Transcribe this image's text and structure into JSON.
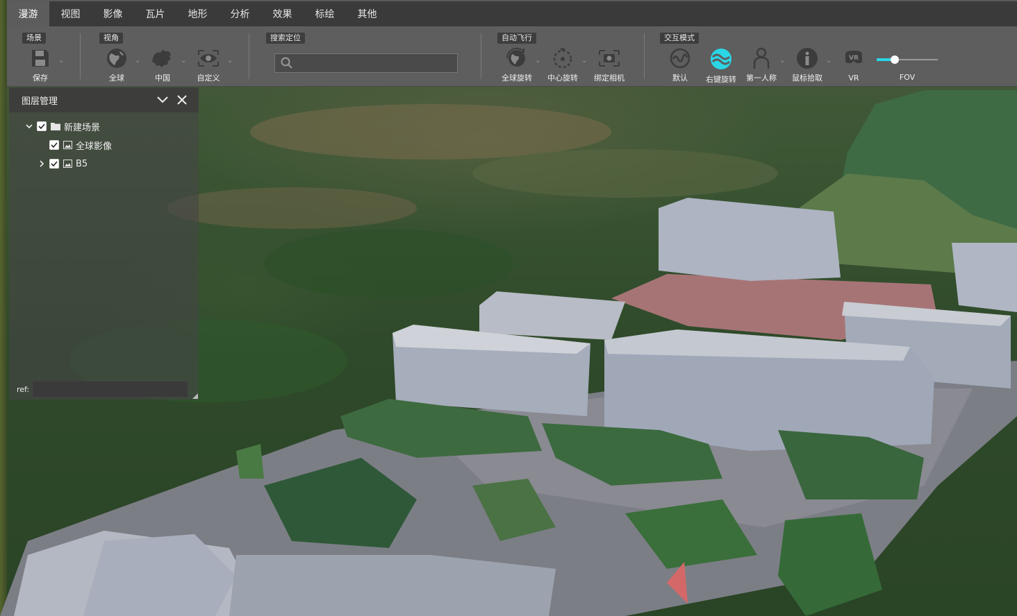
{
  "menu": {
    "tabs": [
      {
        "label": "漫游",
        "active": true
      },
      {
        "label": "视图"
      },
      {
        "label": "影像"
      },
      {
        "label": "瓦片"
      },
      {
        "label": "地形"
      },
      {
        "label": "分析"
      },
      {
        "label": "效果"
      },
      {
        "label": "标绘"
      },
      {
        "label": "其他"
      }
    ]
  },
  "toolbar": {
    "groups": {
      "scene": "场景",
      "view": "视角",
      "search": "搜索定位",
      "autofly": "自动飞行",
      "interact": "交互模式"
    },
    "save_label": "保存",
    "globe_label": "全球",
    "china_label": "中国",
    "custom_label": "自定义",
    "search_placeholder": "",
    "global_rotate_label": "全球旋转",
    "center_rotate_label": "中心旋转",
    "bind_camera_label": "绑定相机",
    "default_label": "默认",
    "right_rotate_label": "右键旋转",
    "first_person_label": "第一人称",
    "mouse_pick_label": "鼠标拾取",
    "vr_label": "VR",
    "vr_icon_text": "VR",
    "fov_label": "FOV",
    "fov_value": 0.3,
    "accent": "#2ad6e6"
  },
  "layer_panel": {
    "title": "图层管理",
    "items": [
      {
        "label": "新建场景",
        "checked": true,
        "icon": "folder-icon",
        "expanded": true
      },
      {
        "label": "全球影像",
        "checked": true,
        "icon": "image-icon"
      },
      {
        "label": "B5",
        "checked": true,
        "icon": "image-icon",
        "expanded": false
      }
    ],
    "ref_label": "ref:",
    "ref_value": ""
  }
}
